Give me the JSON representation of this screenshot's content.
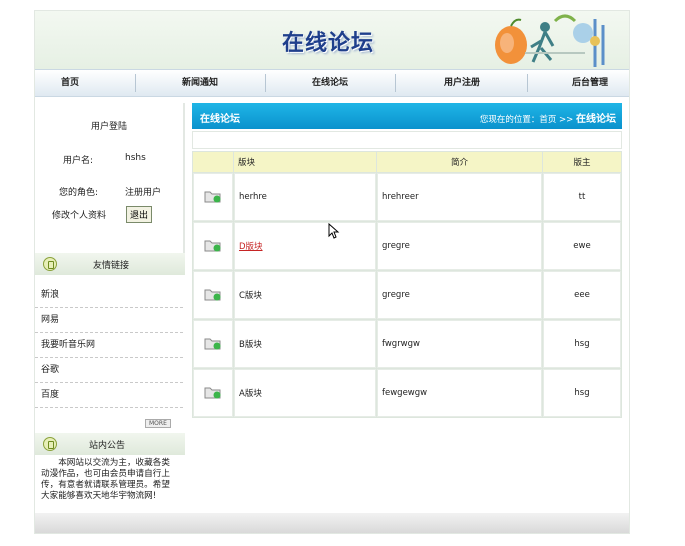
{
  "header": {
    "title": "在线论坛"
  },
  "nav": [
    {
      "label": "首页"
    },
    {
      "label": "新闻通知"
    },
    {
      "label": "在线论坛"
    },
    {
      "label": "用户注册"
    },
    {
      "label": "后台管理"
    }
  ],
  "login": {
    "title": "用户登陆",
    "username_label": "用户名:",
    "username_value": "hshs",
    "role_label": "您的角色:",
    "role_value": "注册用户",
    "edit_profile": "修改个人资料",
    "logout_label": "退出"
  },
  "links": {
    "title": "友情链接",
    "items": [
      "新浪",
      "网易",
      "我要听音乐网",
      "谷歌",
      "百度"
    ],
    "more": "MORE"
  },
  "notice": {
    "title": "站内公告",
    "text": "本网站以交流为主，收藏各类动漫作品，也可由会员申请自行上传，有意者就请联系管理员。希望大家能够喜欢天地华宇物流网!"
  },
  "main": {
    "title": "在线论坛",
    "crumb_prefix": "您现在的位置：首页 >> ",
    "crumb_current": "在线论坛"
  },
  "table": {
    "headers": [
      "版块",
      "简介",
      "版主"
    ],
    "rows": [
      {
        "name": "herhre",
        "desc": "hrehreer",
        "mod": "tt",
        "link": false
      },
      {
        "name": "D版块",
        "desc": "gregre",
        "mod": "ewe",
        "link": true
      },
      {
        "name": "C版块",
        "desc": "gregre",
        "mod": "eee",
        "link": false
      },
      {
        "name": "B版块",
        "desc": "fwgrwgw",
        "mod": "hsg",
        "link": false
      },
      {
        "name": "A版块",
        "desc": "fewgewgw",
        "mod": "hsg",
        "link": false
      }
    ]
  },
  "colors": {
    "accent": "#0a92cd",
    "title": "#1f3f8c",
    "link_red": "#c62424",
    "header_yellow": "#f5f5c6"
  },
  "icons": {
    "section": "book-icon",
    "folder": "folder-icon",
    "cursor": "mouse-cursor-icon"
  }
}
